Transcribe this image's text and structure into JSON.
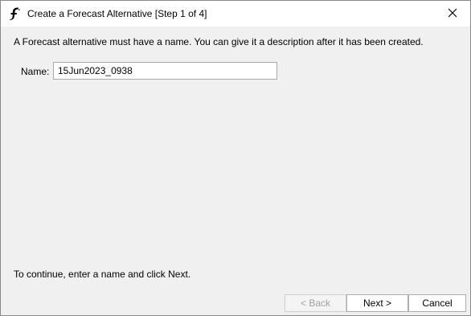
{
  "window": {
    "title": "Create a Forecast Alternative [Step 1 of 4]",
    "app_icon": "hec-logo-icon",
    "close_icon": "close-icon"
  },
  "main": {
    "instruction": "A Forecast alternative must have a name. You can give it a description after it has been created.",
    "name_label": "Name:",
    "name_value": "15Jun2023_0938",
    "hint": "To continue, enter a name and click Next."
  },
  "buttons": {
    "back_label": "< Back",
    "back_enabled": false,
    "next_label": "Next >",
    "cancel_label": "Cancel"
  },
  "colors": {
    "window_background": "#f0f0f0",
    "titlebar_background": "#ffffff",
    "border": "#8a8a8a",
    "disabled_text": "#a0a0a0"
  }
}
